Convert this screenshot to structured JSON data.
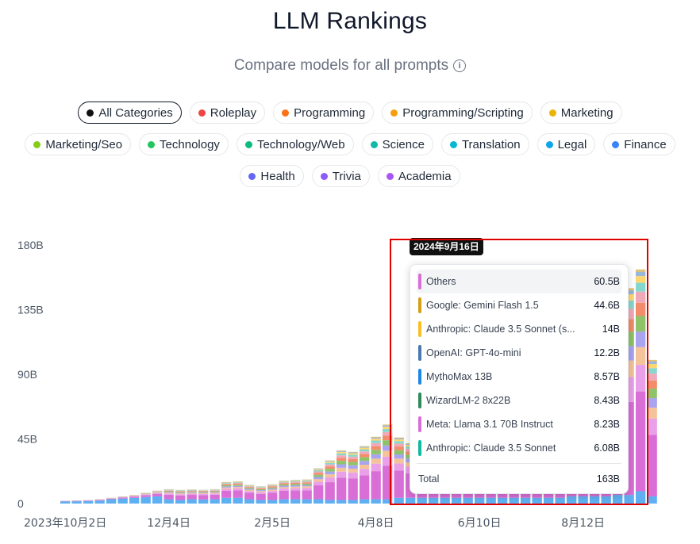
{
  "header": {
    "title": "LLM Rankings",
    "subtitle": "Compare models for all prompts",
    "info_icon": "i"
  },
  "categories": [
    {
      "label": "All Categories",
      "color": "#111111",
      "active": true
    },
    {
      "label": "Roleplay",
      "color": "#ef4444"
    },
    {
      "label": "Programming",
      "color": "#f97316"
    },
    {
      "label": "Programming/Scripting",
      "color": "#f59e0b"
    },
    {
      "label": "Marketing",
      "color": "#eab308"
    },
    {
      "label": "Marketing/Seo",
      "color": "#84cc16"
    },
    {
      "label": "Technology",
      "color": "#22c55e"
    },
    {
      "label": "Technology/Web",
      "color": "#10b981"
    },
    {
      "label": "Science",
      "color": "#14b8a6"
    },
    {
      "label": "Translation",
      "color": "#06b6d4"
    },
    {
      "label": "Legal",
      "color": "#0ea5e9"
    },
    {
      "label": "Finance",
      "color": "#3b82f6"
    },
    {
      "label": "Health",
      "color": "#6366f1"
    },
    {
      "label": "Trivia",
      "color": "#8b5cf6"
    },
    {
      "label": "Academia",
      "color": "#a855f7"
    }
  ],
  "tooltip": {
    "date": "2024年9月16日",
    "rows": [
      {
        "name": "Others",
        "value": "60.5B",
        "color": "#d96fd6"
      },
      {
        "name": "Google: Gemini Flash 1.5",
        "value": "44.6B",
        "color": "#d4a017"
      },
      {
        "name": "Anthropic: Claude 3.5 Sonnet (s...",
        "value": "14B",
        "color": "#fbbf24"
      },
      {
        "name": "OpenAI: GPT-4o-mini",
        "value": "12.2B",
        "color": "#4a78b0"
      },
      {
        "name": "MythoMax 13B",
        "value": "8.57B",
        "color": "#1d87e8"
      },
      {
        "name": "WizardLM-2 8x22B",
        "value": "8.43B",
        "color": "#2e8b57"
      },
      {
        "name": "Meta: Llama 3.1 70B Instruct",
        "value": "8.23B",
        "color": "#d96fd6"
      },
      {
        "name": "Anthropic: Claude 3.5 Sonnet",
        "value": "6.08B",
        "color": "#10b9a0"
      }
    ],
    "total_label": "Total",
    "total_value": "163B"
  },
  "chart_data": {
    "type": "bar",
    "stacked": true,
    "ylim": [
      0,
      180
    ],
    "y_ticks": [
      "180B",
      "135B",
      "90B",
      "45B",
      "0"
    ],
    "y_tick_values": [
      180,
      135,
      90,
      45,
      0
    ],
    "x_tick_labels": [
      "2023年10月2日",
      "12月4日",
      "2月5日",
      "4月8日",
      "6月10日",
      "8月12日"
    ],
    "x_tick_indices": [
      0,
      9,
      18,
      27,
      36,
      45
    ],
    "series_colors": [
      "#5fb0f2",
      "#d96fd6",
      "#e9a0e8",
      "#f4c39a",
      "#a8a4f0",
      "#8fc36a",
      "#f28c6b",
      "#f0a9b7",
      "#86d8cf",
      "#ffd770",
      "#9ab8d8",
      "#e6c06a"
    ],
    "totals": [
      2,
      2.2,
      2.5,
      3,
      4,
      5,
      6,
      7.5,
      9,
      10,
      9.5,
      9.8,
      9.6,
      10,
      15,
      15.5,
      13,
      12,
      13.5,
      16,
      16.5,
      16.8,
      24.5,
      30,
      37,
      36,
      40,
      46.5,
      55,
      46,
      42,
      50,
      45,
      47,
      48,
      52,
      50,
      46,
      54,
      56,
      60,
      65,
      70,
      80,
      100,
      115,
      125,
      130,
      145,
      150,
      163,
      100
    ],
    "blue_base": [
      1.5,
      1.6,
      1.8,
      2,
      3,
      3.5,
      4,
      4.5,
      5,
      3,
      2.5,
      3,
      2.8,
      3,
      4,
      4,
      3,
      2.5,
      2.5,
      3,
      3,
      3,
      3,
      2.5,
      2.5,
      2.5,
      3,
      3,
      3,
      4,
      4,
      4,
      4,
      4,
      4,
      4,
      4,
      4,
      4,
      4,
      4,
      4,
      4,
      4,
      5,
      5,
      5,
      5,
      6,
      6,
      8.57,
      5
    ]
  }
}
